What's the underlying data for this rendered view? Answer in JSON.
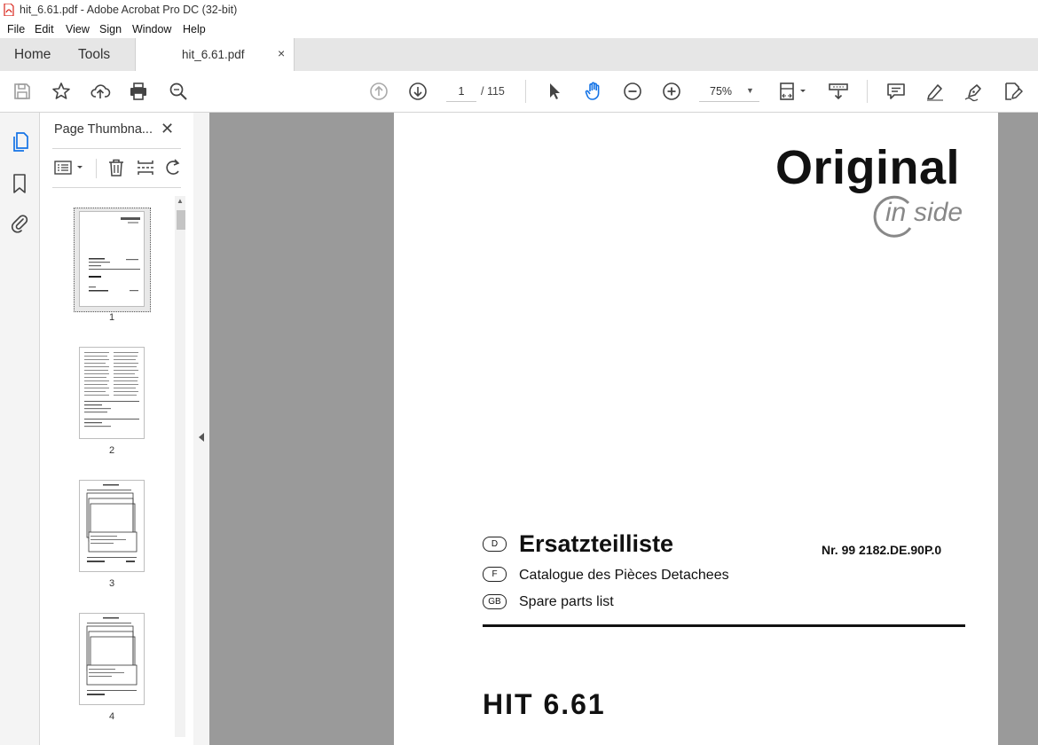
{
  "window": {
    "title": "hit_6.61.pdf - Adobe Acrobat Pro DC (32-bit)"
  },
  "menu": [
    "File",
    "Edit",
    "View",
    "Sign",
    "Window",
    "Help"
  ],
  "tabs": {
    "home": "Home",
    "tools": "Tools",
    "document": "hit_6.61.pdf",
    "close": "×"
  },
  "toolbar": {
    "page_current": "1",
    "page_total": "/ 115",
    "zoom": "75%"
  },
  "thumbnails_panel": {
    "title": "Page Thumbna...",
    "close": "✕",
    "pages": [
      "1",
      "2",
      "3",
      "4"
    ]
  },
  "document": {
    "brand_main": "Original",
    "brand_sub_in": "in",
    "brand_sub_side": "side",
    "lines": [
      {
        "badge": "D",
        "text": "Ersatzteilliste"
      },
      {
        "badge": "F",
        "text": "Catalogue des Pièces Detachees"
      },
      {
        "badge": "GB",
        "text": "Spare parts list"
      }
    ],
    "number": "Nr. 99 2182.DE.90P.0",
    "model": "HIT 6.61"
  },
  "colors": {
    "accent": "#1473e6",
    "viewer_bg": "#9a9a9a"
  }
}
